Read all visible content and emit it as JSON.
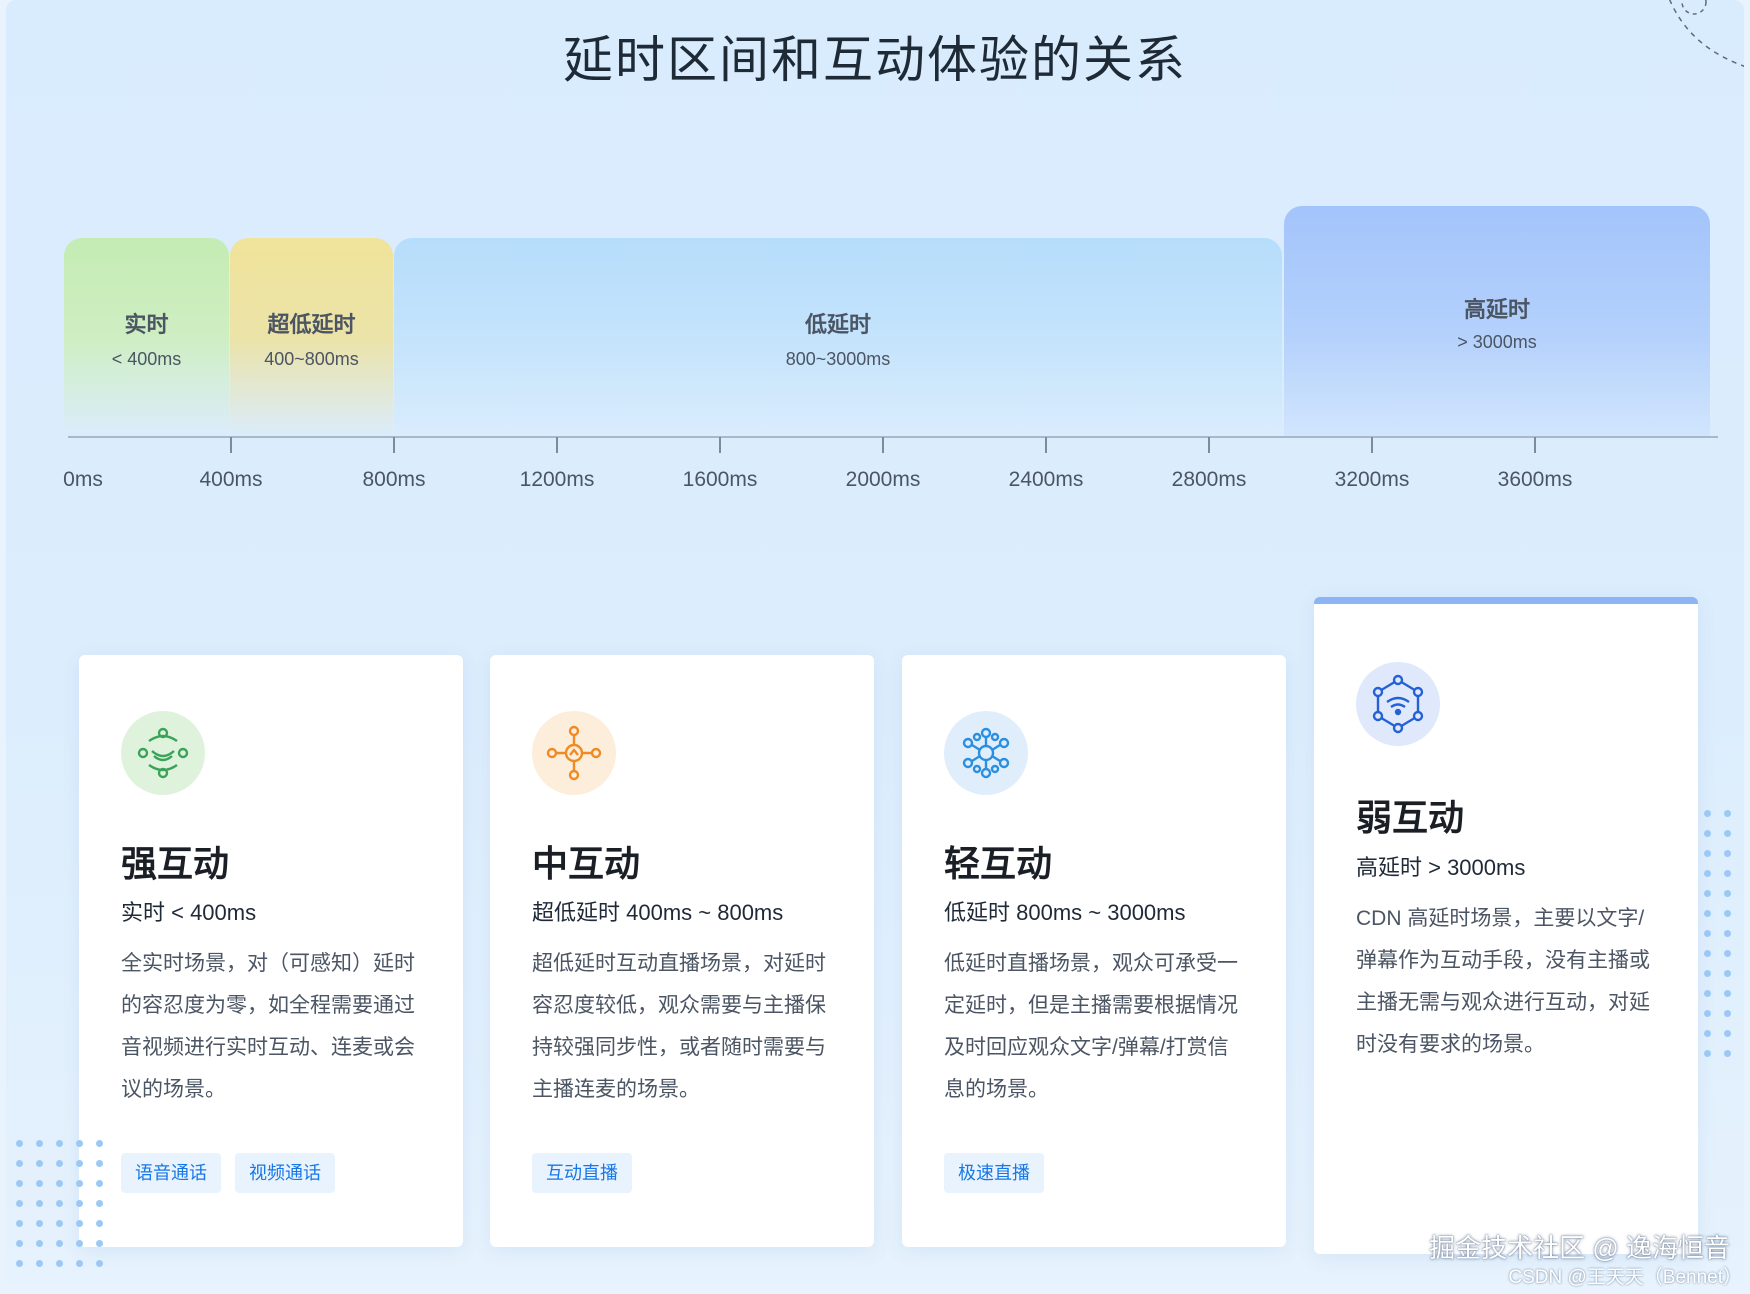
{
  "title": "延时区间和互动体验的关系",
  "zones": [
    {
      "name": "实时",
      "range": "< 400ms"
    },
    {
      "name": "超低延时",
      "range": "400~800ms"
    },
    {
      "name": "低延时",
      "range": "800~3000ms"
    },
    {
      "name": "高延时",
      "range": "> 3000ms"
    }
  ],
  "ticks": [
    "0ms",
    "400ms",
    "800ms",
    "1200ms",
    "1600ms",
    "2000ms",
    "2400ms",
    "2800ms",
    "3200ms",
    "3600ms"
  ],
  "cards": [
    {
      "name": "强互动",
      "range": "实时 < 400ms",
      "desc": "全实时场景，对（可感知）延时的容忍度为零，如全程需要通过音视频进行实时互动、连麦或会议的场景。",
      "tags": [
        "语音通话",
        "视频通话"
      ],
      "icon": "interaction-icon",
      "color": "#3aa35a"
    },
    {
      "name": "中互动",
      "range": "超低延时 400ms ~ 800ms",
      "desc": "超低延时互动直播场景，对延时容忍度较低，观众需要与主播保持较强同步性，或者随时需要与主播连麦的场景。",
      "tags": [
        "互动直播"
      ],
      "icon": "network-hub-icon",
      "color": "#f08a24"
    },
    {
      "name": "轻互动",
      "range": "低延时 800ms ~ 3000ms",
      "desc": "低延时直播场景，观众可承受一定延时，但是主播需要根据情况及时回应观众文字/弹幕/打赏信息的场景。",
      "tags": [
        "极速直播"
      ],
      "icon": "cluster-icon",
      "color": "#2a8fe0"
    },
    {
      "name": "弱互动",
      "range": "高延时 > 3000ms",
      "desc": "CDN 高延时场景，主要以文字/弹幕作为互动手段，没有主播或主播无需与观众进行互动，对延时没有要求的场景。",
      "tags": [],
      "icon": "broadcast-node-icon",
      "color": "#2461d6"
    }
  ],
  "watermark": {
    "line1": "掘金技术社区 @ 逸海恒音",
    "line2": "CSDN @王天天（Bennet）"
  }
}
